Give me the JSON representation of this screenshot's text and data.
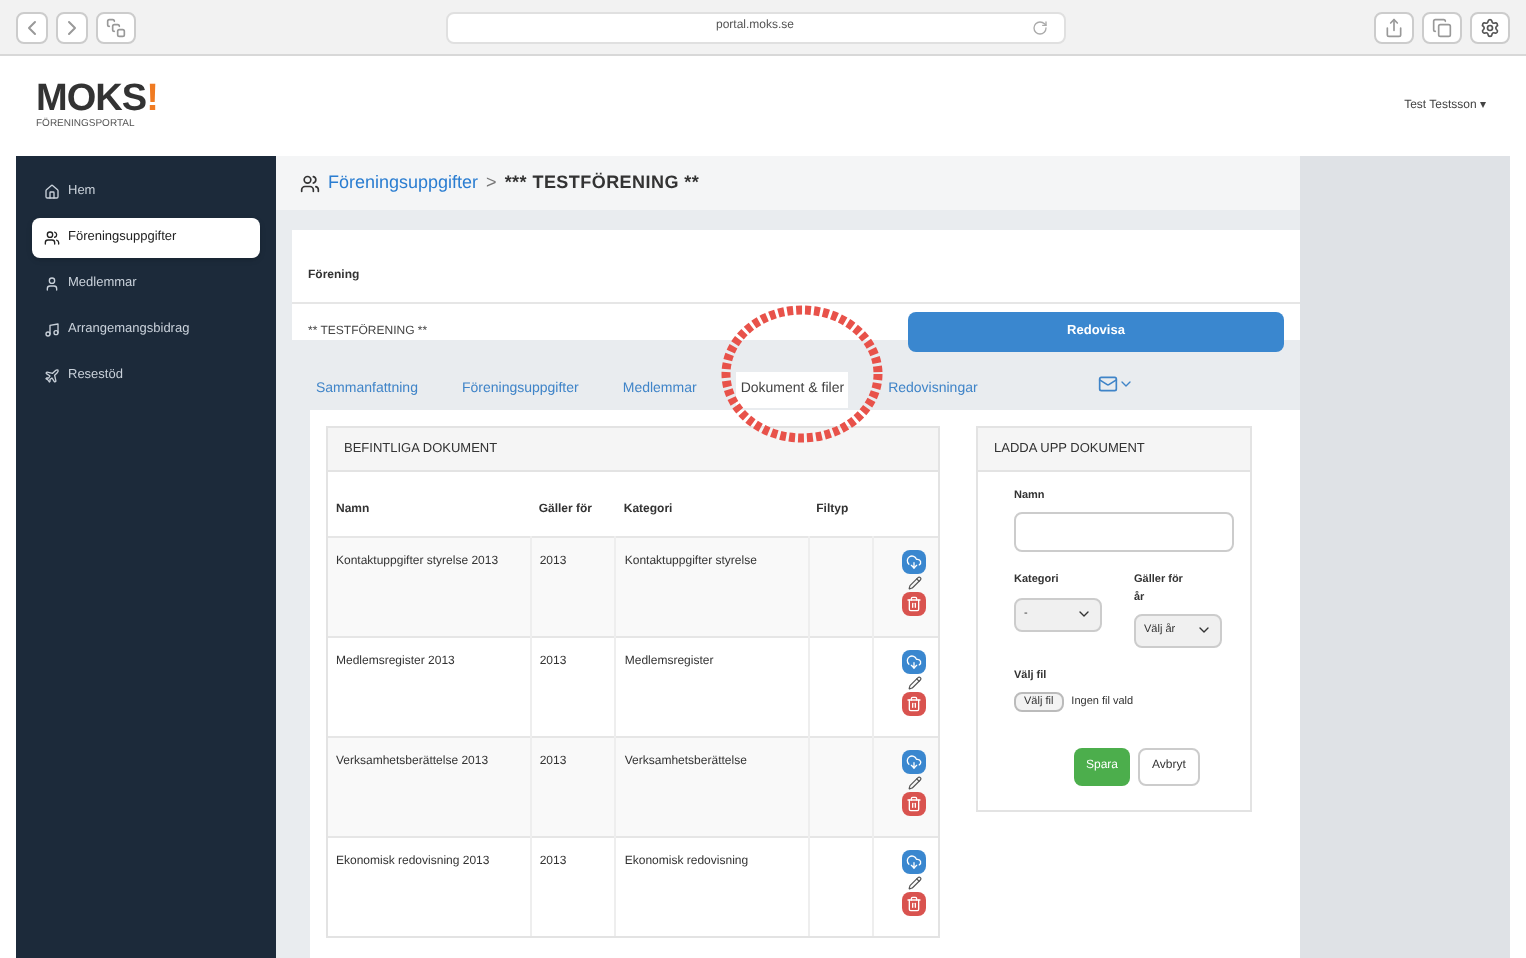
{
  "browser": {
    "url": "portal.moks.se"
  },
  "header": {
    "logo": "MOKS",
    "logo_mark": "!",
    "logo_subtitle": "FÖRENINGSPORTAL",
    "user_menu": "Test Testsson ▾"
  },
  "sidebar": {
    "items": [
      {
        "label": "Hem",
        "selected": false
      },
      {
        "label": "Föreningsuppgifter",
        "selected": true
      },
      {
        "label": "Medlemmar",
        "selected": false
      },
      {
        "label": "Arrangemangsbidrag",
        "selected": false
      },
      {
        "label": "Resestöd",
        "selected": false
      }
    ]
  },
  "breadcrumb": {
    "link": "Föreningsuppgifter",
    "separator": ">",
    "current": "*** TESTFÖRENING **"
  },
  "forening": {
    "label": "Förening",
    "value": "** TESTFÖRENING **",
    "button": "Redovisa"
  },
  "tabs": [
    {
      "label": "Sammanfattning",
      "selected": false
    },
    {
      "label": "Föreningsuppgifter",
      "selected": false
    },
    {
      "label": "Medlemmar",
      "selected": false
    },
    {
      "label": "Dokument & filer",
      "selected": true
    },
    {
      "label": "Redovisningar",
      "selected": false
    }
  ],
  "documents": {
    "title": "BEFINTLIGA DOKUMENT",
    "columns": [
      "Namn",
      "Gäller för",
      "Kategori",
      "Filtyp"
    ],
    "rows": [
      {
        "name": "Kontaktuppgifter styrelse 2013",
        "year": "2013",
        "category": "Kontaktuppgifter styrelse"
      },
      {
        "name": "Medlemsregister 2013",
        "year": "2013",
        "category": "Medlemsregister"
      },
      {
        "name": "Verksamhetsberättelse 2013",
        "year": "2013",
        "category": "Verksamhetsberättelse"
      },
      {
        "name": "Ekonomisk redovisning 2013",
        "year": "2013",
        "category": "Ekonomisk redovisning"
      }
    ]
  },
  "upload": {
    "title": "LADDA UPP DOKUMENT",
    "name_label": "Namn",
    "category_label": "Kategori",
    "category_value": "-",
    "year_label": "Gäller för år",
    "year_value": "Välj år",
    "file_label": "Välj fil",
    "file_button": "Välj fil",
    "file_status": "Ingen fil vald",
    "save": "Spara",
    "cancel": "Avbryt"
  },
  "annotations": [
    {
      "kind": "circle",
      "color": "#e8524a"
    }
  ]
}
